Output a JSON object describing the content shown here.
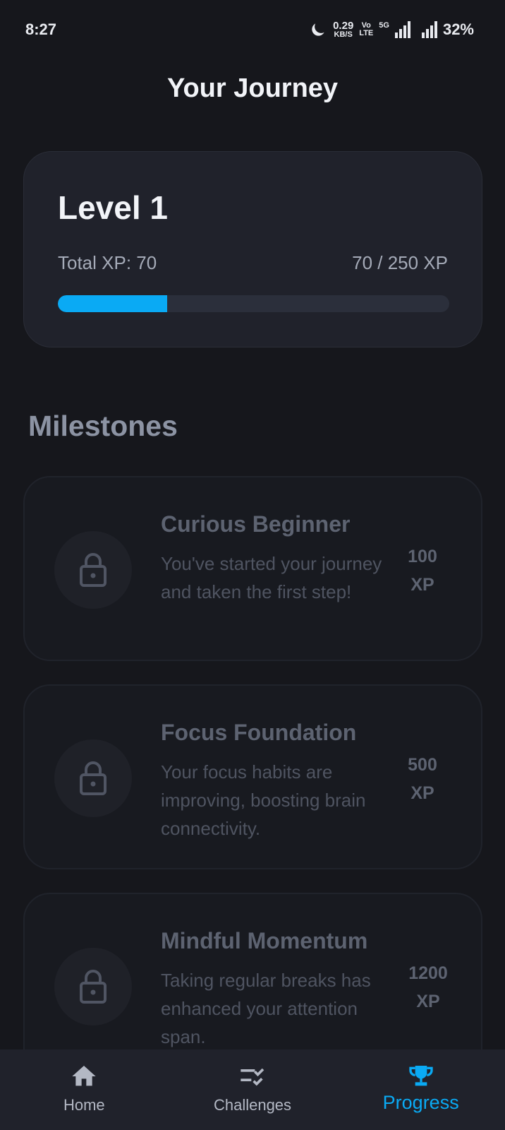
{
  "status_bar": {
    "time": "8:27",
    "net_speed_value": "0.29",
    "net_speed_unit": "KB/S",
    "volte_top": "Vo",
    "volte_bottom": "LTE",
    "network": "5G",
    "battery": "32%",
    "icons": [
      "moon-icon",
      "signal-icon",
      "signal-icon"
    ]
  },
  "page": {
    "title": "Your Journey"
  },
  "level_card": {
    "level_label": "Level 1",
    "total_xp_label": "Total XP: 70",
    "progress_label": "70 / 250 XP",
    "progress_fraction": 0.28,
    "accent_color": "#0aaaf4"
  },
  "milestones": {
    "title": "Milestones",
    "items": [
      {
        "title": "Curious Beginner",
        "description": "You've started your journey and taken the first step!",
        "xp_value": "100",
        "xp_unit": "XP",
        "icon": "lock-icon"
      },
      {
        "title": "Focus Foundation",
        "description": "Your focus habits are improving, boosting brain connectivity.",
        "xp_value": "500",
        "xp_unit": "XP",
        "icon": "lock-icon"
      },
      {
        "title": "Mindful Momentum",
        "description": "Taking regular breaks has enhanced your attention span.",
        "xp_value": "1200",
        "xp_unit": "XP",
        "icon": "lock-icon"
      }
    ]
  },
  "bottom_nav": {
    "items": [
      {
        "label": "Home",
        "icon": "home-icon",
        "active": false
      },
      {
        "label": "Challenges",
        "icon": "checklist-icon",
        "active": false
      },
      {
        "label": "Progress",
        "icon": "trophy-icon",
        "active": true
      }
    ]
  }
}
